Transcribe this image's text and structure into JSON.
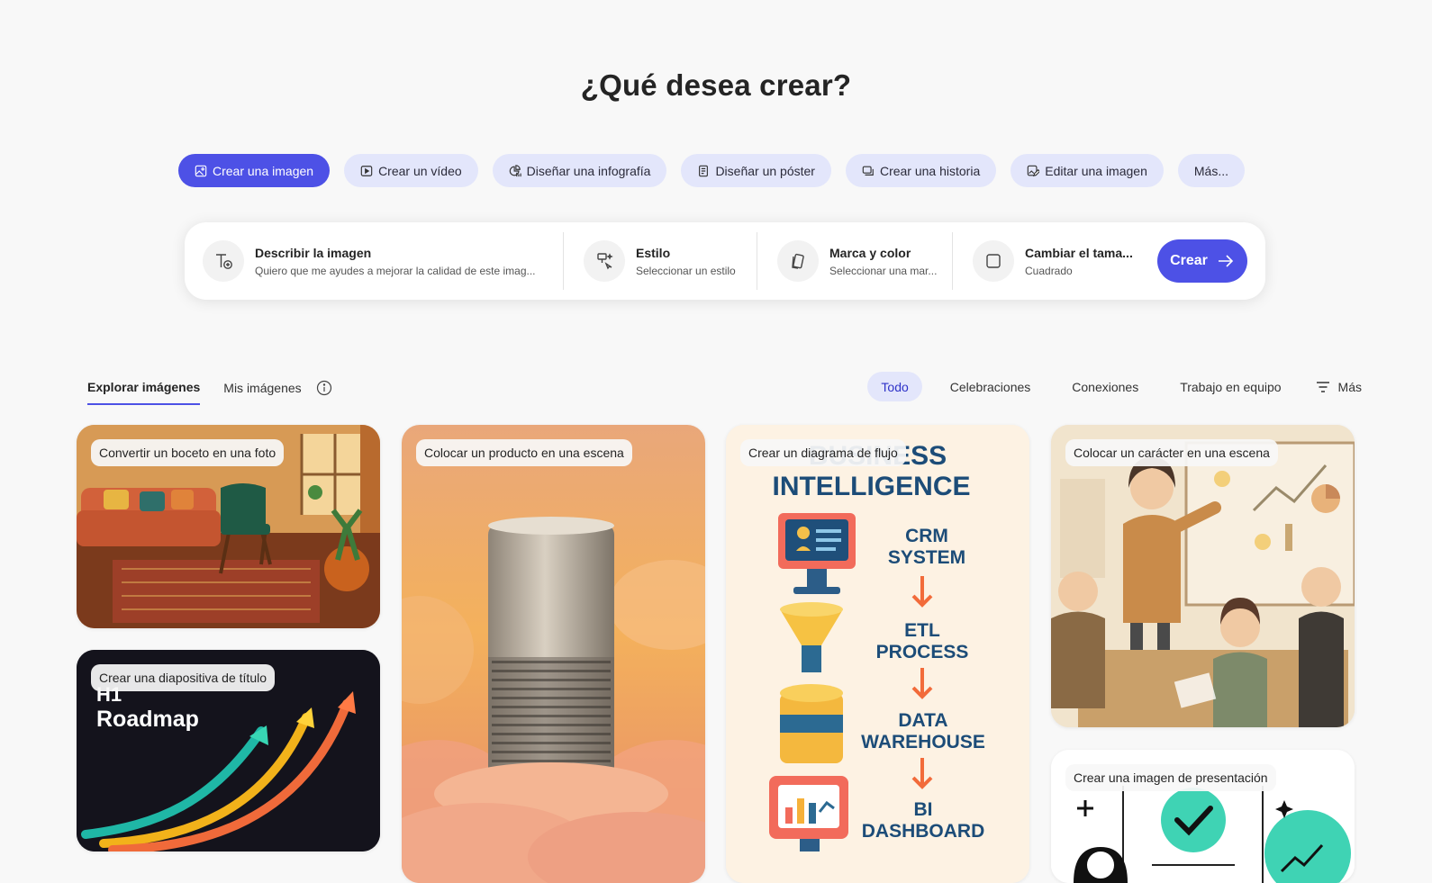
{
  "page": {
    "title": "¿Qué desea crear?"
  },
  "pills": [
    {
      "label": "Crear una imagen",
      "icon": "image-icon",
      "active": true
    },
    {
      "label": "Crear un vídeo",
      "icon": "video-icon",
      "active": false
    },
    {
      "label": "Diseñar una infografía",
      "icon": "infographic-icon",
      "active": false
    },
    {
      "label": "Diseñar un póster",
      "icon": "poster-icon",
      "active": false
    },
    {
      "label": "Crear una historia",
      "icon": "story-icon",
      "active": false
    },
    {
      "label": "Editar una imagen",
      "icon": "edit-image-icon",
      "active": false
    },
    {
      "label": "Más...",
      "icon": "",
      "active": false
    }
  ],
  "prompt_bar": {
    "describe": {
      "title": "Describir la imagen",
      "value": "Quiero que me ayudes a mejorar la calidad de este imag...",
      "icon": "text-add-icon"
    },
    "style": {
      "title": "Estilo",
      "value": "Seleccionar un estilo",
      "icon": "style-icon"
    },
    "brand": {
      "title": "Marca y color",
      "value": "Seleccionar una mar...",
      "icon": "brand-color-icon"
    },
    "size": {
      "title": "Cambiar el tama...",
      "value": "Cuadrado",
      "icon": "square-icon"
    },
    "create_label": "Crear"
  },
  "tabs": [
    {
      "label": "Explorar imágenes",
      "active": true
    },
    {
      "label": "Mis imágenes",
      "active": false
    }
  ],
  "filters": {
    "chips": [
      {
        "label": "Todo",
        "active": true
      },
      {
        "label": "Celebraciones",
        "active": false
      },
      {
        "label": "Conexiones",
        "active": false
      },
      {
        "label": "Trabajo en equipo",
        "active": false
      }
    ],
    "more_label": "Más"
  },
  "cards": {
    "sketch": {
      "label": "Convertir un boceto en una foto"
    },
    "title_slide": {
      "label": "Crear una diapositiva de título",
      "art_text": [
        "H1",
        "Roadmap"
      ]
    },
    "product": {
      "label": "Colocar un producto en una escena"
    },
    "flowchart": {
      "label": "Crear un diagrama de flujo",
      "art_text": [
        "BUSINESS",
        "INTELLIGENCE",
        "CRM",
        "SYSTEM",
        "ETL",
        "PROCESS",
        "DATA",
        "WAREHOUSE",
        "BI",
        "DASHBOARD"
      ]
    },
    "character": {
      "label": "Colocar un carácter en una escena"
    },
    "presentation": {
      "label": "Crear una imagen de presentación"
    }
  },
  "colors": {
    "accent": "#4d51e6",
    "pill_bg": "#e3e6fb",
    "page_bg": "#f8f8f8"
  }
}
